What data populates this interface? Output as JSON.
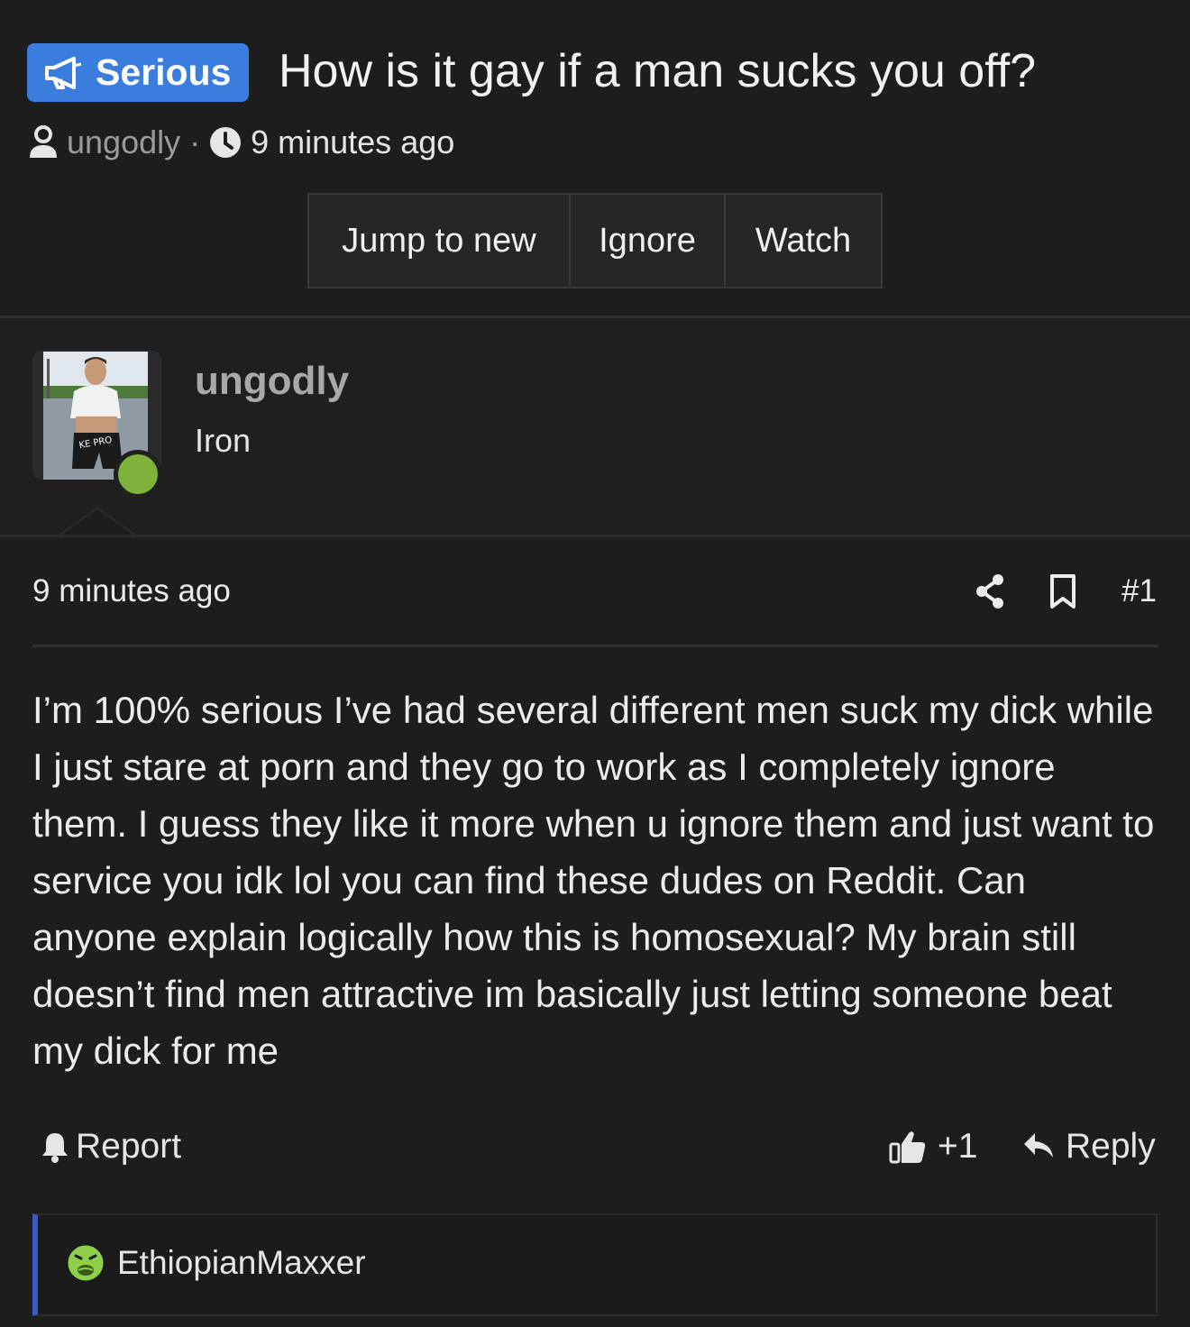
{
  "thread": {
    "prefix_label": "Serious",
    "prefix_color": "#3b7ddd",
    "title": "How is it gay if a man sucks you off?",
    "author": "ungodly",
    "separator": "·",
    "time": "9 minutes ago"
  },
  "actions": {
    "jump_to_new": "Jump to new",
    "ignore": "Ignore",
    "watch": "Watch"
  },
  "user": {
    "name": "ungodly",
    "title": "Iron",
    "online": true,
    "online_color": "#7fb23a"
  },
  "post": {
    "time": "9 minutes ago",
    "number": "#1",
    "body": "I’m 100% serious I’ve had several different men suck my dick while I just stare at porn and they go to work as I completely ignore them. I guess they like it more when u ignore them and just want to service you idk lol you can find these dudes on Reddit. Can anyone explain logically how this is homosexual? My brain still doesn’t find men attractive im basically just letting someone beat my dick for me",
    "report_label": "Report",
    "like_count": "+1",
    "reply_label": "Reply"
  },
  "quote": {
    "author": "EthiopianMaxxer",
    "icon": "nauseated-face-icon"
  },
  "icons": [
    "megaphone-icon",
    "user-icon",
    "clock-icon",
    "share-icon",
    "bookmark-icon",
    "bell-icon",
    "thumbs-up-icon",
    "reply-icon"
  ]
}
